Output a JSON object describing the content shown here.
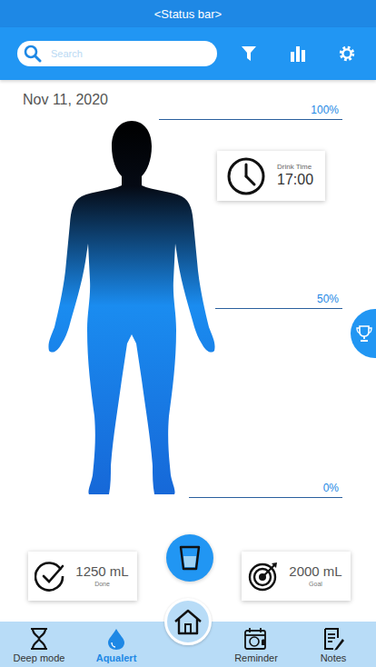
{
  "status_bar": {
    "text": "<Status bar>"
  },
  "search": {
    "placeholder": "Search"
  },
  "date": "Nov 11, 2020",
  "gauge": {
    "level": 0.625,
    "marks": [
      {
        "label": "100%",
        "level": 1
      },
      {
        "label": "50%",
        "level": 0.5
      },
      {
        "label": "0%",
        "level": 0
      }
    ]
  },
  "drink_time": {
    "label": "Drink Time",
    "value": "17:00"
  },
  "done": {
    "value": "1250 mL",
    "label": "Done"
  },
  "goal": {
    "value": "2000 mL",
    "label": "Goal"
  },
  "nav": [
    {
      "label": "Deep mode",
      "selected": false
    },
    {
      "label": "Aqualert",
      "selected": true
    },
    {
      "label": "Reminder",
      "selected": false
    },
    {
      "label": "Notes",
      "selected": false
    }
  ]
}
